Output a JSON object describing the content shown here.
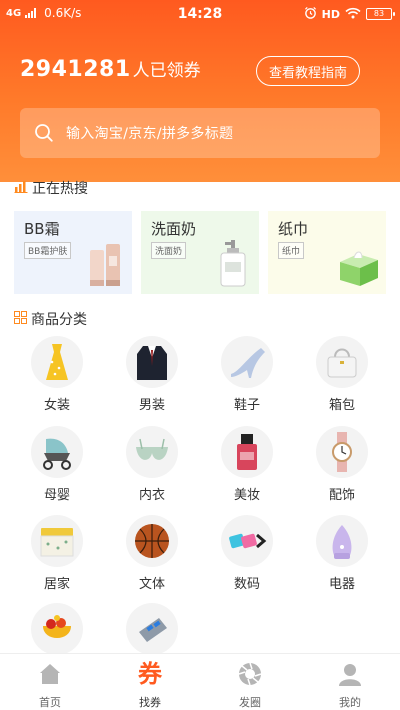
{
  "status_bar": {
    "network": "4G",
    "speed": "0.6K/s",
    "time": "14:28",
    "hd": "HD",
    "battery": "83"
  },
  "header": {
    "count": "2941281",
    "count_suffix": "人已领券",
    "guide_button": "查看教程指南"
  },
  "search": {
    "placeholder": "输入淘宝/京东/拼多多标题"
  },
  "hot_search": {
    "title": "正在热搜",
    "items": [
      {
        "name": "BB霜",
        "tag": "BB霜护肤",
        "bg": "#eef3fc"
      },
      {
        "name": "洗面奶",
        "tag": "洗面奶",
        "bg": "#eef9ea"
      },
      {
        "name": "纸巾",
        "tag": "纸巾",
        "bg": "#fcfcea"
      }
    ]
  },
  "categories": {
    "title": "商品分类",
    "items": [
      {
        "label": "女装",
        "icon": "dress-icon"
      },
      {
        "label": "男装",
        "icon": "suit-icon"
      },
      {
        "label": "鞋子",
        "icon": "high-heel-icon"
      },
      {
        "label": "箱包",
        "icon": "handbag-icon"
      },
      {
        "label": "母婴",
        "icon": "stroller-icon"
      },
      {
        "label": "内衣",
        "icon": "bra-icon"
      },
      {
        "label": "美妆",
        "icon": "cosmetics-icon"
      },
      {
        "label": "配饰",
        "icon": "watch-icon"
      },
      {
        "label": "居家",
        "icon": "storage-box-icon"
      },
      {
        "label": "文体",
        "icon": "basketball-icon"
      },
      {
        "label": "数码",
        "icon": "cables-icon"
      },
      {
        "label": "电器",
        "icon": "humidifier-icon"
      },
      {
        "label": "",
        "icon": "food-icon"
      },
      {
        "label": "",
        "icon": "car-charger-icon"
      }
    ]
  },
  "tabbar": {
    "items": [
      {
        "label": "首页",
        "icon": "home-icon"
      },
      {
        "label": "找券",
        "icon": "coupon-icon",
        "glyph": "券"
      },
      {
        "label": "发圈",
        "icon": "aperture-icon"
      },
      {
        "label": "我的",
        "icon": "user-icon"
      }
    ]
  },
  "colors": {
    "accent": "#ff5a1f",
    "header_gradient_end": "#ff8f3a"
  }
}
